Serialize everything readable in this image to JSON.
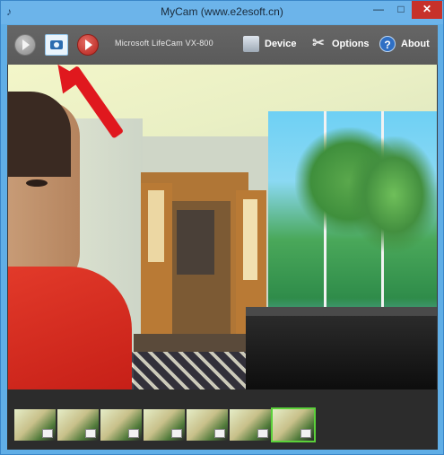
{
  "window": {
    "title": "MyCam (www.e2esoft.cn)",
    "controls": {
      "minimize": "—",
      "maximize": "□",
      "close": "✕"
    }
  },
  "toolbar": {
    "device_name": "Microsoft LifeCam VX-800",
    "menu": [
      {
        "label": "Device",
        "icon": "webcam-icon"
      },
      {
        "label": "Options",
        "icon": "tools-icon"
      },
      {
        "label": "About",
        "icon": "help-icon"
      }
    ],
    "buttons": [
      {
        "name": "play-button",
        "icon": "play-icon"
      },
      {
        "name": "snapshot-button",
        "icon": "camera-icon"
      },
      {
        "name": "record-button",
        "icon": "record-icon"
      }
    ]
  },
  "thumbnails": {
    "count": 7,
    "selected_index": 6
  },
  "colors": {
    "accent": "#60aee6",
    "close": "#c7312a",
    "arrow": "#e0181e",
    "selected": "#5bd13a"
  }
}
